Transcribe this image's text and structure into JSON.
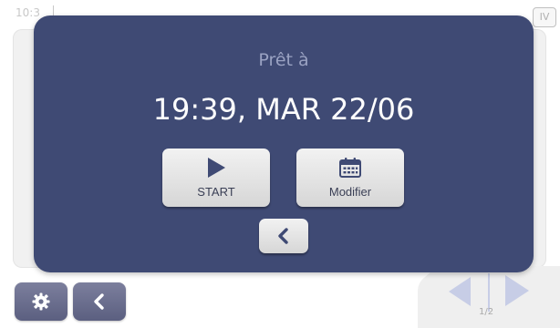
{
  "background": {
    "clock_text": "10:3",
    "badge_text": "IV",
    "page_indicator": "1/2",
    "icons": {
      "settings": "gear-icon",
      "back": "chevron-left-icon",
      "nav_previous": "triangle-left-icon",
      "nav_next": "triangle-right-icon"
    }
  },
  "dialog": {
    "title": "Prêt à",
    "datetime": "19:39, MAR 22/06",
    "start_button": {
      "label": "START",
      "icon": "play-icon"
    },
    "modify_button": {
      "label": "Modifier",
      "icon": "calendar-icon"
    },
    "back_button": {
      "icon": "chevron-left-icon"
    }
  },
  "colors": {
    "dialog_background": "#3f4a74",
    "dialog_title": "#9aa2c2",
    "dialog_text": "#ffffff",
    "button_face": "#e4e4e4",
    "icon_accent": "#3f4a74",
    "bottom_button": "#6b6f8e",
    "nav_arrow": "#c7cde6"
  }
}
